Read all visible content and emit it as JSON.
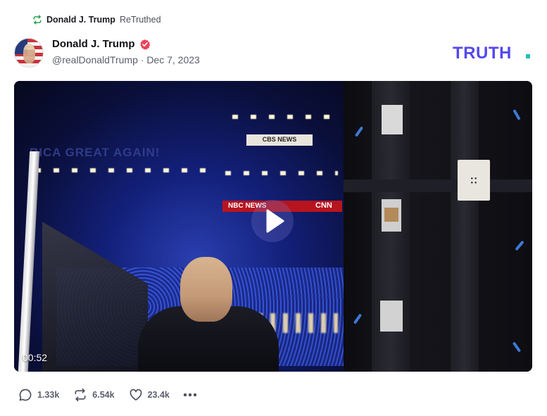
{
  "retruth": {
    "name": "Donald J. Trump",
    "suffix": "ReTruthed",
    "icon": "retruth-icon",
    "icon_color": "#2aa44f"
  },
  "post": {
    "author_name": "Donald J. Trump",
    "verified_icon": "verified-badge-icon",
    "verified_color": "#e8465a",
    "handle": "@realDonaldTrump",
    "separator": "·",
    "date": "Dec 7, 2023",
    "brand_logo": "TRUTH.",
    "brand_color": "#5448ee",
    "brand_dot_color": "#1ec4b5"
  },
  "video": {
    "duration": "00:52",
    "play_icon": "play-icon",
    "scene_text": {
      "banner": "RICA GREAT AGAIN!",
      "cbs_sign": "CBS NEWS",
      "nbc_sign": "NBC NEWS",
      "cnn_sign": "CNN"
    }
  },
  "actions": {
    "replies": {
      "icon": "reply-icon",
      "count": "1.33k"
    },
    "retruths": {
      "icon": "retruth-icon",
      "count": "6.54k"
    },
    "likes": {
      "icon": "heart-icon",
      "count": "23.4k"
    },
    "more": {
      "icon": "more-icon"
    }
  }
}
